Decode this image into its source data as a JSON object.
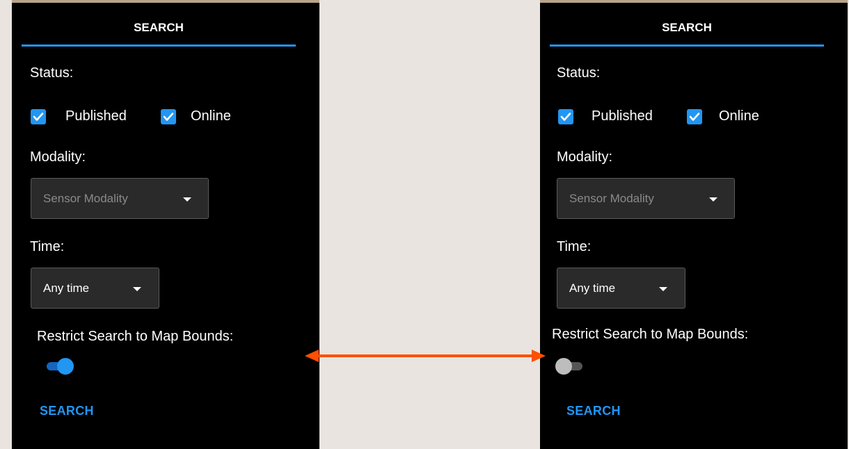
{
  "colors": {
    "accent": "#2196f3",
    "panel_bg": "#000000",
    "page_bg": "#e9e4e0",
    "arrow": "#ff4f00",
    "toggle_on_track": "#1565c0",
    "toggle_off_thumb": "#bdbdbd",
    "toggle_off_track": "#555555"
  },
  "panels": [
    {
      "tab_label": "SEARCH",
      "status_label": "Status:",
      "checkboxes": [
        {
          "label": "Published",
          "checked": true,
          "icon": "check-icon"
        },
        {
          "label": "Online",
          "checked": true,
          "icon": "check-icon"
        }
      ],
      "modality_label": "Modality:",
      "modality_select": {
        "placeholder": "Sensor Modality",
        "icon": "caret-down-icon"
      },
      "time_label": "Time:",
      "time_select": {
        "value": "Any time",
        "icon": "caret-down-icon"
      },
      "restrict_label": "Restrict Search to Map Bounds:",
      "restrict_toggle_on": true,
      "search_button": "SEARCH"
    },
    {
      "tab_label": "SEARCH",
      "status_label": "Status:",
      "checkboxes": [
        {
          "label": "Published",
          "checked": true,
          "icon": "check-icon"
        },
        {
          "label": "Online",
          "checked": true,
          "icon": "check-icon"
        }
      ],
      "modality_label": "Modality:",
      "modality_select": {
        "placeholder": "Sensor Modality",
        "icon": "caret-down-icon"
      },
      "time_label": "Time:",
      "time_select": {
        "value": "Any time",
        "icon": "caret-down-icon"
      },
      "restrict_label": "Restrict Search to Map Bounds:",
      "restrict_toggle_on": false,
      "search_button": "SEARCH"
    }
  ],
  "annotation": {
    "icon": "double-headed-arrow-icon"
  }
}
